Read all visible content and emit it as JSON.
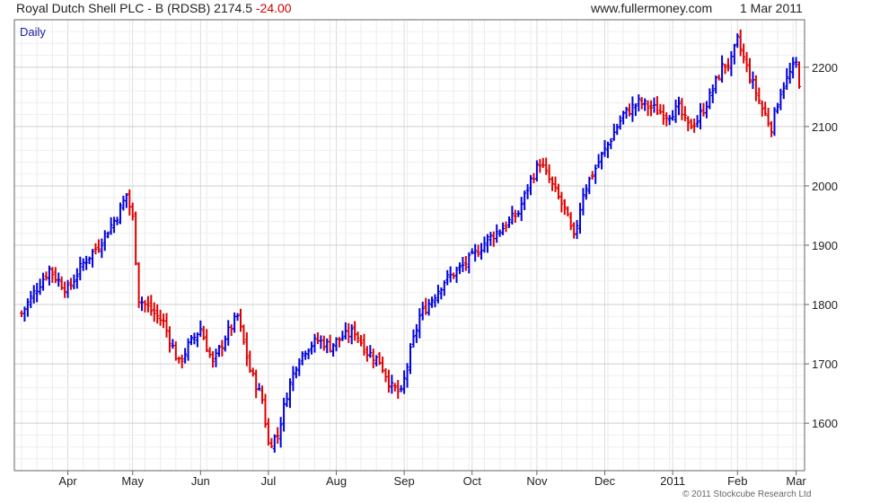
{
  "header": {
    "title": "Royal Dutch Shell PLC - B (RDSB) 2174.5",
    "change": "-24.00",
    "site": "www.fullermoney.com",
    "date": "1 Mar 2011"
  },
  "copyright": "© 2011 Stockcube Research Ltd",
  "colors": {
    "up": "#0000dd",
    "down": "#dd0000",
    "grid": "#dcdcdc",
    "frame": "#666666"
  },
  "chart_data": {
    "type": "line",
    "series_label": "Daily",
    "ylim": [
      1520,
      2280
    ],
    "y_ticks": [
      1600,
      1700,
      1800,
      1900,
      2000,
      2100,
      2200
    ],
    "x_months": [
      {
        "label": "Apr",
        "day": 15
      },
      {
        "label": "May",
        "day": 36
      },
      {
        "label": "Jun",
        "day": 58
      },
      {
        "label": "Jul",
        "day": 80
      },
      {
        "label": "Aug",
        "day": 102
      },
      {
        "label": "Sep",
        "day": 124
      },
      {
        "label": "Oct",
        "day": 146
      },
      {
        "label": "Nov",
        "day": 167
      },
      {
        "label": "Dec",
        "day": 189
      },
      {
        "label": "2011",
        "day": 211
      },
      {
        "label": "Feb",
        "day": 232
      },
      {
        "label": "Mar",
        "day": 251
      }
    ],
    "total_days": 253,
    "anchors": [
      [
        0,
        1785
      ],
      [
        4,
        1820
      ],
      [
        9,
        1860
      ],
      [
        12,
        1840
      ],
      [
        15,
        1825
      ],
      [
        20,
        1870
      ],
      [
        25,
        1900
      ],
      [
        28,
        1925
      ],
      [
        31,
        1950
      ],
      [
        34,
        1985
      ],
      [
        36,
        1945
      ],
      [
        38,
        1810
      ],
      [
        42,
        1790
      ],
      [
        46,
        1770
      ],
      [
        51,
        1700
      ],
      [
        54,
        1730
      ],
      [
        58,
        1760
      ],
      [
        62,
        1700
      ],
      [
        66,
        1745
      ],
      [
        70,
        1780
      ],
      [
        74,
        1690
      ],
      [
        78,
        1640
      ],
      [
        80,
        1565
      ],
      [
        83,
        1580
      ],
      [
        86,
        1650
      ],
      [
        89,
        1700
      ],
      [
        92,
        1725
      ],
      [
        96,
        1740
      ],
      [
        100,
        1730
      ],
      [
        104,
        1745
      ],
      [
        108,
        1755
      ],
      [
        112,
        1720
      ],
      [
        116,
        1705
      ],
      [
        120,
        1660
      ],
      [
        123,
        1650
      ],
      [
        126,
        1720
      ],
      [
        129,
        1780
      ],
      [
        133,
        1810
      ],
      [
        137,
        1840
      ],
      [
        142,
        1860
      ],
      [
        146,
        1880
      ],
      [
        151,
        1910
      ],
      [
        156,
        1930
      ],
      [
        161,
        1955
      ],
      [
        165,
        2010
      ],
      [
        168,
        2040
      ],
      [
        172,
        2000
      ],
      [
        176,
        1960
      ],
      [
        179,
        1910
      ],
      [
        182,
        1990
      ],
      [
        186,
        2030
      ],
      [
        191,
        2080
      ],
      [
        195,
        2120
      ],
      [
        200,
        2140
      ],
      [
        205,
        2130
      ],
      [
        209,
        2120
      ],
      [
        213,
        2130
      ],
      [
        216,
        2100
      ],
      [
        219,
        2110
      ],
      [
        223,
        2150
      ],
      [
        227,
        2200
      ],
      [
        230,
        2210
      ],
      [
        232,
        2245
      ],
      [
        236,
        2185
      ],
      [
        240,
        2130
      ],
      [
        243,
        2100
      ],
      [
        246,
        2160
      ],
      [
        249,
        2190
      ],
      [
        251,
        2205
      ],
      [
        252,
        2175
      ]
    ]
  }
}
